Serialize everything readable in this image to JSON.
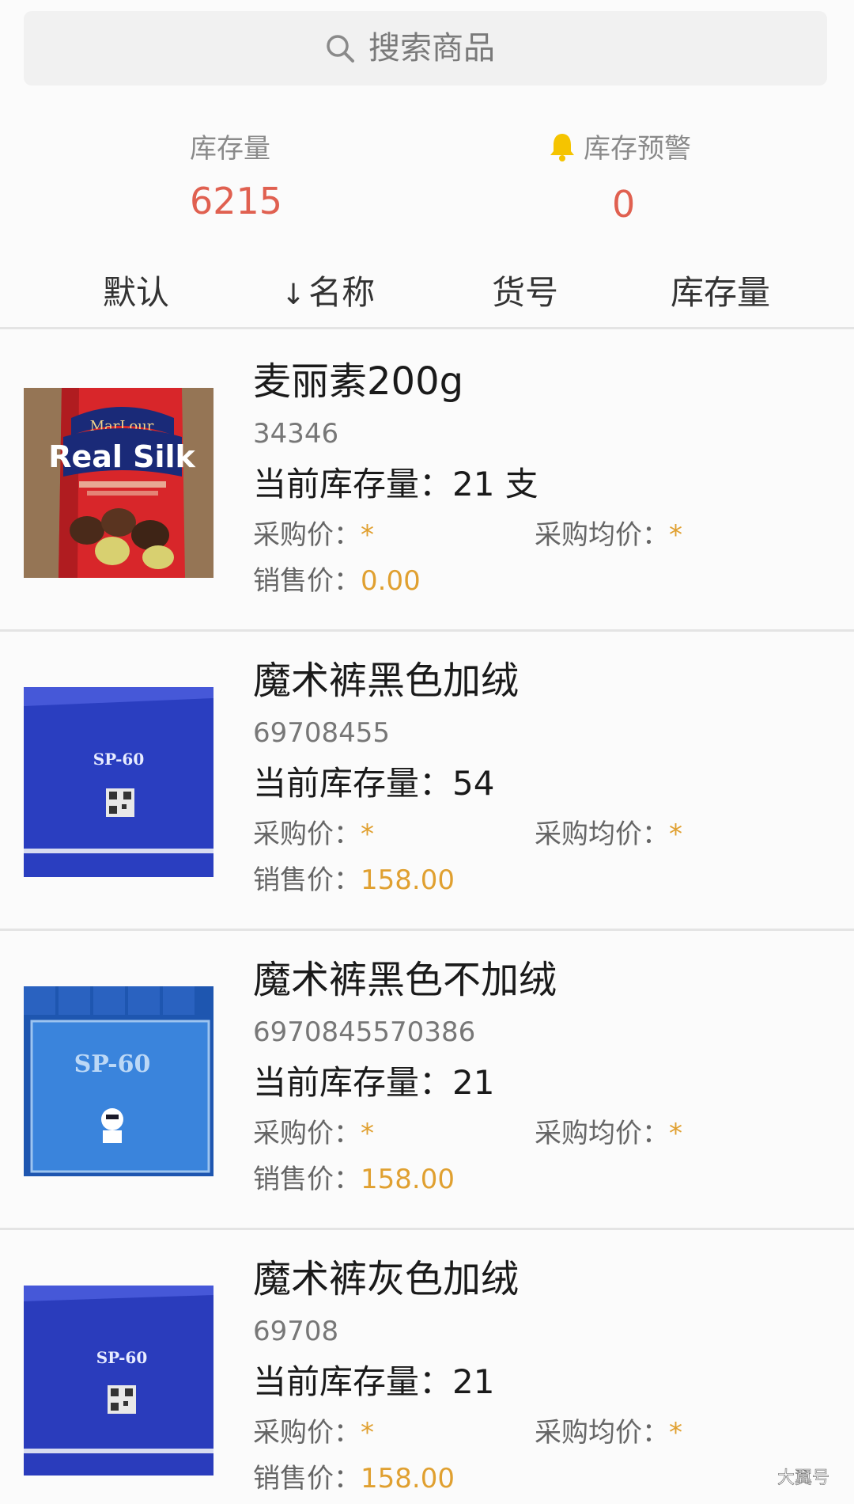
{
  "search": {
    "placeholder": "搜索商品"
  },
  "stats": {
    "stock_label": "库存量",
    "stock_value": "6215",
    "warning_label": "库存预警",
    "warning_value": "0",
    "value_color": "#e06050"
  },
  "sort_tabs": [
    {
      "label": "默认",
      "arrow": ""
    },
    {
      "label": "名称",
      "arrow": "↓"
    },
    {
      "label": "货号",
      "arrow": ""
    },
    {
      "label": "库存量",
      "arrow": ""
    }
  ],
  "items": [
    {
      "name": "麦丽素200g",
      "code": "34346",
      "stock_text": "当前库存量：21 支",
      "purchase_label": "采购价：",
      "purchase_value": "*",
      "avg_label": "采购均价：",
      "avg_value": "*",
      "sale_label": "销售价：",
      "sale_value": "0.00",
      "image": "marlour-real-silk-can",
      "image_text": {
        "brand": "MarLour",
        "product": "Real Silk"
      }
    },
    {
      "name": "魔术裤黑色加绒",
      "code": "69708455",
      "stock_text": "当前库存量：54",
      "purchase_label": "采购价：",
      "purchase_value": "*",
      "avg_label": "采购均价：",
      "avg_value": "*",
      "sale_label": "销售价：",
      "sale_value": "158.00",
      "image": "blue-sp60-box",
      "image_text": {
        "product": "SP-60"
      }
    },
    {
      "name": "魔术裤黑色不加绒",
      "code": "6970845570386",
      "stock_text": "当前库存量：21",
      "purchase_label": "采购价：",
      "purchase_value": "*",
      "avg_label": "采购均价：",
      "avg_value": "*",
      "sale_label": "销售价：",
      "sale_value": "158.00",
      "image": "light-blue-sp60-box",
      "image_text": {
        "product": "SP-60"
      }
    },
    {
      "name": "魔术裤灰色加绒",
      "code": "69708",
      "stock_text": "当前库存量：21",
      "purchase_label": "采购价：",
      "purchase_value": "*",
      "avg_label": "采购均价：",
      "avg_value": "*",
      "sale_label": "销售价：",
      "sale_value": "158.00",
      "image": "blue-sp60-box",
      "image_text": {
        "product": "SP-60"
      }
    }
  ],
  "colors": {
    "price_accent": "#e0a030",
    "divider": "#e4e4e4"
  },
  "watermark": "大翼号"
}
